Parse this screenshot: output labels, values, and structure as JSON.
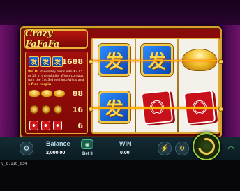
{
  "game": {
    "logo_text": "Crazy FaFaFa"
  },
  "paytable": {
    "wild_text_prefix": "WILD:",
    "wild_text_body": "Randomly turns into X2 X5 or X8 in the middle. When combos turn the 1st 3rd reel into Wilds and",
    "wild_text_highlight": "1 free respin",
    "rows": [
      {
        "symbol": "fa-symbol",
        "payout": "1688"
      },
      {
        "symbol": "gold-ingot",
        "payout": "88"
      },
      {
        "symbol": "gold-coin",
        "payout": "16"
      },
      {
        "symbol": "red-envelope",
        "payout": "6"
      }
    ]
  },
  "reels": {
    "columns": [
      [
        "fa-symbol",
        "fa-symbol"
      ],
      [
        "fa-symbol",
        "red-envelope"
      ],
      [
        "gold-ingot",
        "red-envelope"
      ]
    ],
    "fa_glyph": "发"
  },
  "controls": {
    "balance_label": "Balance",
    "balance_value": "2,000.00",
    "bet_label": "Bet 3",
    "win_label": "WIN",
    "win_value": "0.00"
  },
  "footer": {
    "version": "v_0.110_034"
  },
  "colors": {
    "cabinet_red": "#8b0a0a",
    "gold_trim": "#e2a834",
    "fa_blue": "#1f6fe0",
    "payline": "#ffb300",
    "spin_green": "#9ccf3a"
  }
}
